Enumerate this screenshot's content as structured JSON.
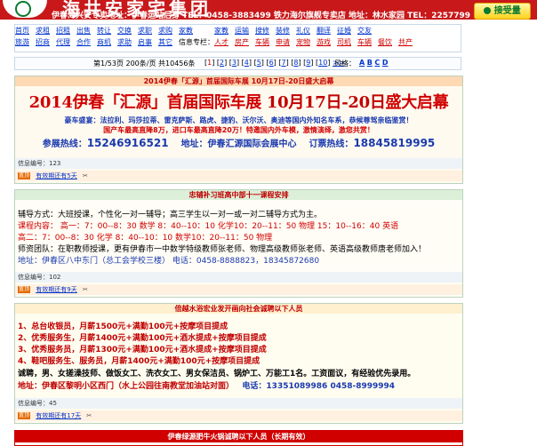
{
  "banner": {
    "title": "海共安家宅集团",
    "contact": "伊春海兴安专卖地址：伊春运站后身 TEL：0458-3883499    铁力海尔旗舰专卖店 地址：林水家园 TEL：2257799",
    "promo": "接受量"
  },
  "nav": {
    "row1": [
      "首页",
      "求租",
      "招租",
      "出售",
      "转让",
      "交换",
      "求职",
      "求购",
      "家教",
      "家教",
      "运输",
      "搜修",
      "装修",
      "礼仪",
      "翻译",
      "征婚",
      "交友"
    ],
    "row2": [
      "旅游",
      "招商",
      "代理",
      "合作",
      "商机",
      "求助",
      "启事",
      "其它",
      "信息专栏：",
      "人才",
      "房产",
      "车辆",
      "申请",
      "宠物",
      "游戏",
      "司机",
      "车辆",
      "餐饮",
      "共产"
    ],
    "red_items": [
      "人才",
      "房产",
      "车辆",
      "申请",
      "宠物",
      "游戏",
      "司机",
      "车辆",
      "餐饮",
      "共产"
    ]
  },
  "pager": {
    "info": "第1/53页  200条/页  共10456条",
    "pages": [
      "1",
      "2",
      "3",
      "4",
      "5",
      "6",
      "7",
      "8",
      "9",
      "10"
    ],
    "current": "1",
    "extra": ">>",
    "letters_label": "风格：",
    "letters": [
      "A",
      "B",
      "C",
      "D"
    ]
  },
  "ads": [
    {
      "header": "2014伊春「汇源」首届国际车展 10月17日-20日盛大启幕",
      "title_prefix": "2014伊春「汇源」首届国际车展 ",
      "title_date": "10月17日-20日",
      "title_suffix": "盛大启幕",
      "brands": "豪车盛宴：法拉利、玛莎拉蒂、雷克萨斯、路虎、捷豹、沃尔沃、奥迪等国内外知名车系，恭候尊驾亲临鉴赏！",
      "promo": "国产车最高直降8万，进口车最高直降20万！特邀国内外车模，激情演绎，激您共赏！",
      "hotline_label": "参展热线：",
      "hotline": "15246916521",
      "addr_label": "地址：",
      "addr": "伊春汇源国际会展中心",
      "ticket_label": "订票热线：",
      "ticket": "18845819995",
      "info_label": "信息编号：",
      "info_no": "123",
      "tag": "置顶",
      "valid": "有效期还有5天"
    },
    {
      "header": "忠辅补习班高中部十一课程安排",
      "line1": "辅导方式：大班授课，个性化一对一辅导；高三学生以一对一或一对二辅导方式为主。",
      "line2": "课程内容：  高一：7：00--8：30  数学    8：40--10：10  化学10：20--11：50  物理      15：10--16：40  英语",
      "line3": "           高二：7：00--8：30  化学    8：40--10：10  数学10：20--11：50  物理",
      "line4": "师资团队：在职教师授课，更有伊春市一中数学特级教师张老师、物理高级教师张老师、英语高级教师唐老师加入！",
      "line5": "地址：伊春区八中东门（总工会学校三楼）  电话：0458-8888823，18345872680",
      "info_label": "信息编号：",
      "info_no": "102",
      "tag": "置顶",
      "valid": "有效期还有9天"
    },
    {
      "header": "倍越水浴宏业发开画向社会诚聘以下人员",
      "jobs": [
        "1、总台收银员，月薪1500元+满勤100元+按摩项目提成",
        "2、优秀服务生，月薪1400元+满勤100元+酒水提成+按摩项目提成",
        "3、优秀服务员，月薪1300元+满勤100元+酒水提成+按摩项目提成",
        "4、鞋吧服务生、服务员，月薪1400元+满勤100元+按摩项目提成"
      ],
      "line5": "诚聘，男、女搓澡技师、做饭女工、洗衣女工、男女保洁员、锅炉工、万能工1名。工资面议，有经验优先录用。",
      "addr": "地址：伊春区黎明小区西门（水上公园往南教堂加油站对面）",
      "phone": "电话：13351089986    0458-8999994",
      "info_label": "信息编号：",
      "info_no": "45",
      "tag": "置顶",
      "valid": "有效期还有17天"
    },
    {
      "header": "伊春绿源肥牛火锅诚聘以下人员（长期有效）"
    }
  ],
  "colors": {
    "banner_red": "#c8181a",
    "link_blue": "#0033cc",
    "accent_red": "#d00000"
  }
}
